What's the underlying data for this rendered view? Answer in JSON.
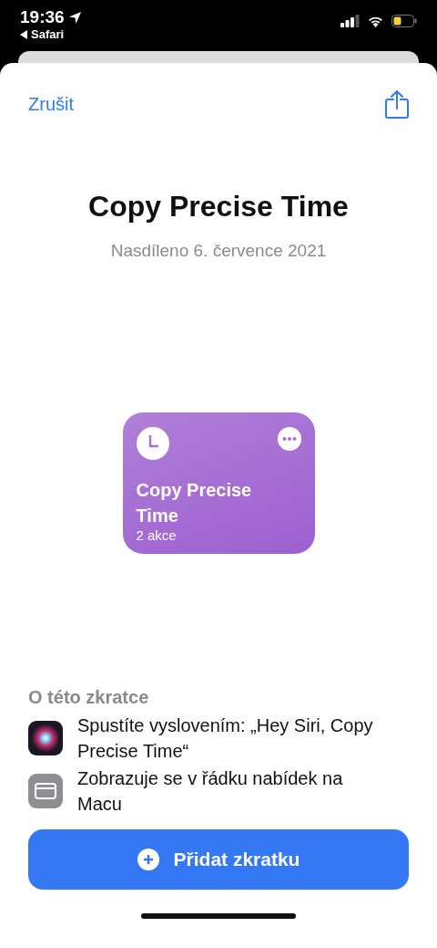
{
  "status_bar": {
    "time": "19:36",
    "back_label": "Safari"
  },
  "sheet": {
    "cancel": "Zrušit",
    "title": "Copy Precise Time",
    "subtitle": "Nasdíleno 6. července 2021"
  },
  "shortcut_card": {
    "name": "Copy Precise Time",
    "actions": "2 akce"
  },
  "about": {
    "heading": "O této zkratce",
    "items": [
      {
        "kind": "siri",
        "text": "Spustíte vyslovením: „Hey Siri, Copy Precise Time“"
      },
      {
        "kind": "menubar",
        "text": "Zobrazuje se v řádku nabídek na Macu"
      }
    ]
  },
  "add_button": {
    "label": "Přidat zkratku"
  }
}
